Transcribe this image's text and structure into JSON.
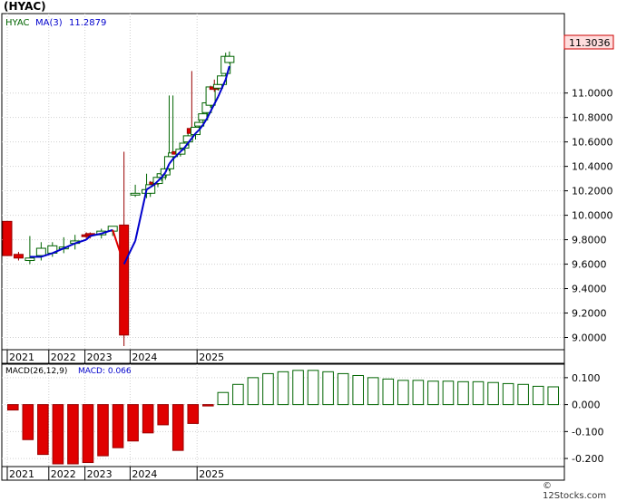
{
  "title": "(HYAC)",
  "credit": "© 12Stocks.com",
  "price_panel": {
    "ticker": "HYAC",
    "ma_label": "MA(3)",
    "ma_value": "11.2879",
    "last_price": "11.3036",
    "y_ticks": [
      "11.0000",
      "10.8000",
      "10.6000",
      "10.4000",
      "10.2000",
      "10.0000",
      "9.8000",
      "9.6000",
      "9.4000",
      "9.2000",
      "9.0000"
    ]
  },
  "macd_panel": {
    "label": "MACD(26,12,9)",
    "value_label": "MACD: 0.066",
    "y_ticks": [
      "0.100",
      "0.000",
      "-0.100",
      "-0.200"
    ]
  },
  "x_labels": [
    "2021",
    "2022",
    "2023",
    "2024",
    "2025"
  ],
  "colors": {
    "up_candle": "#006400",
    "down_candle": "#e00000",
    "ma_up": "#0000cc",
    "ma_down": "#e00000",
    "price_box": "#ffdddd"
  },
  "chart_data": [
    {
      "type": "candlestick",
      "title": "(HYAC)",
      "ylim": [
        8.9,
        11.65
      ],
      "x": [
        "2021-01",
        "2021-04",
        "2021-07",
        "2021-10",
        "2022-01",
        "2022-04",
        "2022-07",
        "2022-10",
        "2022-11",
        "2023-02",
        "2023-05",
        "2023-08",
        "2023-11",
        "2024-02",
        "2024-03",
        "2024-04",
        "2024-05",
        "2024-06",
        "2024-07",
        "2024-08",
        "2024-09",
        "2024-10",
        "2024-11",
        "2024-12",
        "2025-01",
        "2025-02",
        "2025-03",
        "2025-04",
        "2025-05",
        "2025-06",
        "2025-07",
        "2025-08",
        "2025-09",
        "2025-10",
        "2025-11",
        "2025-12"
      ],
      "candles": [
        {
          "open": 9.95,
          "high": 9.95,
          "low": 9.67,
          "close": 9.67
        },
        {
          "open": 9.68,
          "high": 9.7,
          "low": 9.63,
          "close": 9.65
        },
        {
          "open": 9.63,
          "high": 9.83,
          "low": 9.6,
          "close": 9.65
        },
        {
          "open": 9.67,
          "high": 9.78,
          "low": 9.63,
          "close": 9.73
        },
        {
          "open": 9.69,
          "high": 9.78,
          "low": 9.66,
          "close": 9.75
        },
        {
          "open": 9.73,
          "high": 9.82,
          "low": 9.69,
          "close": 9.74
        },
        {
          "open": 9.77,
          "high": 9.84,
          "low": 9.72,
          "close": 9.79
        },
        {
          "open": 9.84,
          "high": 9.86,
          "low": 9.8,
          "close": 9.83
        },
        {
          "open": 9.85,
          "high": 9.86,
          "low": 9.81,
          "close": 9.84
        },
        {
          "open": 9.84,
          "high": 9.89,
          "low": 9.81,
          "close": 9.87
        },
        {
          "open": 9.87,
          "high": 9.91,
          "low": 9.83,
          "close": 9.91
        },
        {
          "open": 9.92,
          "high": 10.52,
          "low": 8.93,
          "close": 9.02
        },
        {
          "open": 10.18,
          "high": 10.25,
          "low": 10.15,
          "close": 10.18
        },
        {
          "open": 10.18,
          "high": 10.34,
          "low": 10.14,
          "close": 10.21
        },
        {
          "open": 10.18,
          "high": 10.28,
          "low": 10.15,
          "close": 10.25
        },
        {
          "open": 10.27,
          "high": 10.29,
          "low": 10.24,
          "close": 10.26
        },
        {
          "open": 10.26,
          "high": 10.33,
          "low": 10.23,
          "close": 10.31
        },
        {
          "open": 10.31,
          "high": 10.34,
          "low": 10.28,
          "close": 10.34
        },
        {
          "open": 10.33,
          "high": 10.4,
          "low": 10.29,
          "close": 10.38
        },
        {
          "open": 10.38,
          "high": 10.98,
          "low": 10.36,
          "close": 10.48
        },
        {
          "open": 10.48,
          "high": 10.98,
          "low": 10.45,
          "close": 10.51
        },
        {
          "open": 10.52,
          "high": 10.53,
          "low": 10.49,
          "close": 10.5
        },
        {
          "open": 10.5,
          "high": 10.55,
          "low": 10.48,
          "close": 10.54
        },
        {
          "open": 10.55,
          "high": 10.62,
          "low": 10.53,
          "close": 10.59
        },
        {
          "open": 10.6,
          "high": 10.67,
          "low": 10.57,
          "close": 10.65
        },
        {
          "open": 10.71,
          "high": 11.18,
          "low": 10.66,
          "close": 10.67
        },
        {
          "open": 10.66,
          "high": 10.76,
          "low": 10.62,
          "close": 10.72
        },
        {
          "open": 10.73,
          "high": 10.79,
          "low": 10.7,
          "close": 10.76
        },
        {
          "open": 10.78,
          "high": 10.9,
          "low": 10.75,
          "close": 10.83
        },
        {
          "open": 10.84,
          "high": 10.96,
          "low": 10.8,
          "close": 10.92
        },
        {
          "open": 10.9,
          "high": 11.06,
          "low": 10.88,
          "close": 11.05
        },
        {
          "open": 11.05,
          "high": 11.11,
          "low": 11.01,
          "close": 11.03
        },
        {
          "open": 11.04,
          "high": 11.08,
          "low": 11.02,
          "close": 11.07
        },
        {
          "open": 11.07,
          "high": 11.15,
          "low": 11.05,
          "close": 11.14
        },
        {
          "open": 11.16,
          "high": 11.33,
          "low": 11.14,
          "close": 11.3
        },
        {
          "open": 11.25,
          "high": 11.34,
          "low": 11.24,
          "close": 11.3
        }
      ],
      "ma_series": {
        "name": "MA(3)",
        "values": [
          null,
          null,
          9.66,
          9.66,
          9.69,
          9.73,
          9.77,
          9.8,
          9.83,
          9.85,
          9.88,
          9.6,
          9.79,
          10.21,
          10.23,
          10.25,
          10.28,
          10.31,
          10.35,
          10.42,
          10.46,
          10.49,
          10.52,
          10.55,
          10.59,
          10.63,
          10.67,
          10.7,
          10.74,
          10.79,
          10.85,
          10.91,
          10.97,
          11.04,
          11.11,
          11.22
        ]
      }
    },
    {
      "type": "bar",
      "title": "MACD(26,12,9)",
      "ylim": [
        -0.23,
        0.15
      ],
      "values": [
        -0.02,
        -0.13,
        -0.185,
        -0.22,
        -0.22,
        -0.215,
        -0.19,
        -0.16,
        -0.135,
        -0.105,
        -0.075,
        -0.17,
        -0.07,
        -0.005,
        0.045,
        0.075,
        0.1,
        0.115,
        0.122,
        0.127,
        0.127,
        0.122,
        0.115,
        0.108,
        0.1,
        0.095,
        0.09,
        0.09,
        0.087,
        0.087,
        0.085,
        0.085,
        0.082,
        0.078,
        0.075,
        0.068,
        0.066
      ]
    }
  ]
}
